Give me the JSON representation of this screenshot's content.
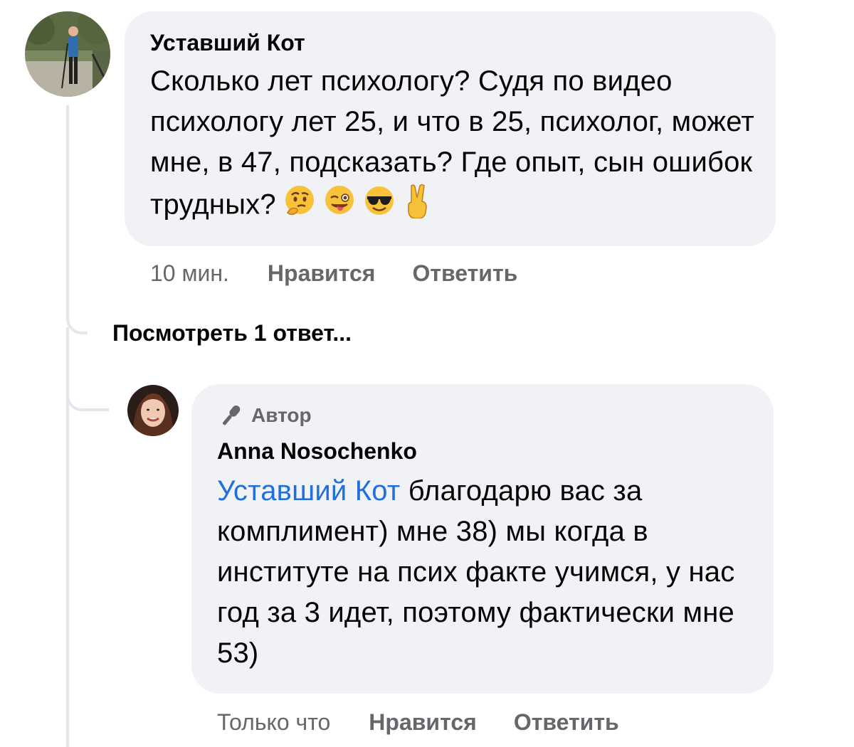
{
  "comment": {
    "author": "Уставший Кот",
    "text": "Сколько лет психологу? Судя по видео психологу лет 25, и что в 25, психолог, может мне, в 47, подсказать? Где опыт, сын ошибок трудных?",
    "emojis": [
      "thinking-face-icon",
      "winking-tongue-face-icon",
      "sunglasses-face-icon",
      "victory-hand-icon"
    ],
    "time": "10 мин.",
    "like_label": "Нравится",
    "reply_label": "Ответить"
  },
  "view_replies": "Посмотреть 1 ответ...",
  "reply": {
    "badge_icon": "microphone-icon",
    "badge": "Автор",
    "author": "Anna Nosochenko",
    "mention": "Уставший Кот",
    "text": "благодарю вас за комплимент) мне 38) мы когда в институте на псих факте учимся, у нас год за 3 идет, поэтому фактически мне 53)",
    "time": "Только что",
    "like_label": "Нравится",
    "reply_label": "Ответить"
  },
  "colors": {
    "bubble": "#f0f2f5",
    "mention": "#216fdb",
    "meta": "#65676b",
    "thread_line": "#e4e6eb"
  }
}
